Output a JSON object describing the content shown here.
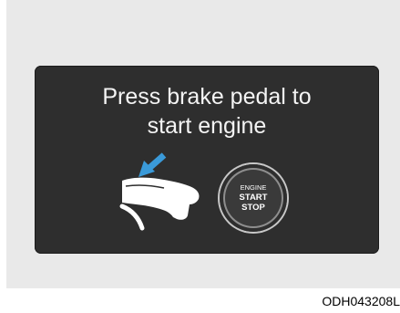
{
  "display": {
    "message_line1": "Press brake pedal to",
    "message_line2": "start engine"
  },
  "engine_button": {
    "line1": "ENGINE",
    "line2": "START",
    "line3": "STOP"
  },
  "figure_code": "ODH043208L",
  "icons": {
    "arrow": "arrow-down-left-icon",
    "pedal": "brake-pedal-foot-icon"
  },
  "colors": {
    "panel": "#2e2e2e",
    "arrow": "#3a9ad9",
    "text": "#f4f4f4"
  }
}
